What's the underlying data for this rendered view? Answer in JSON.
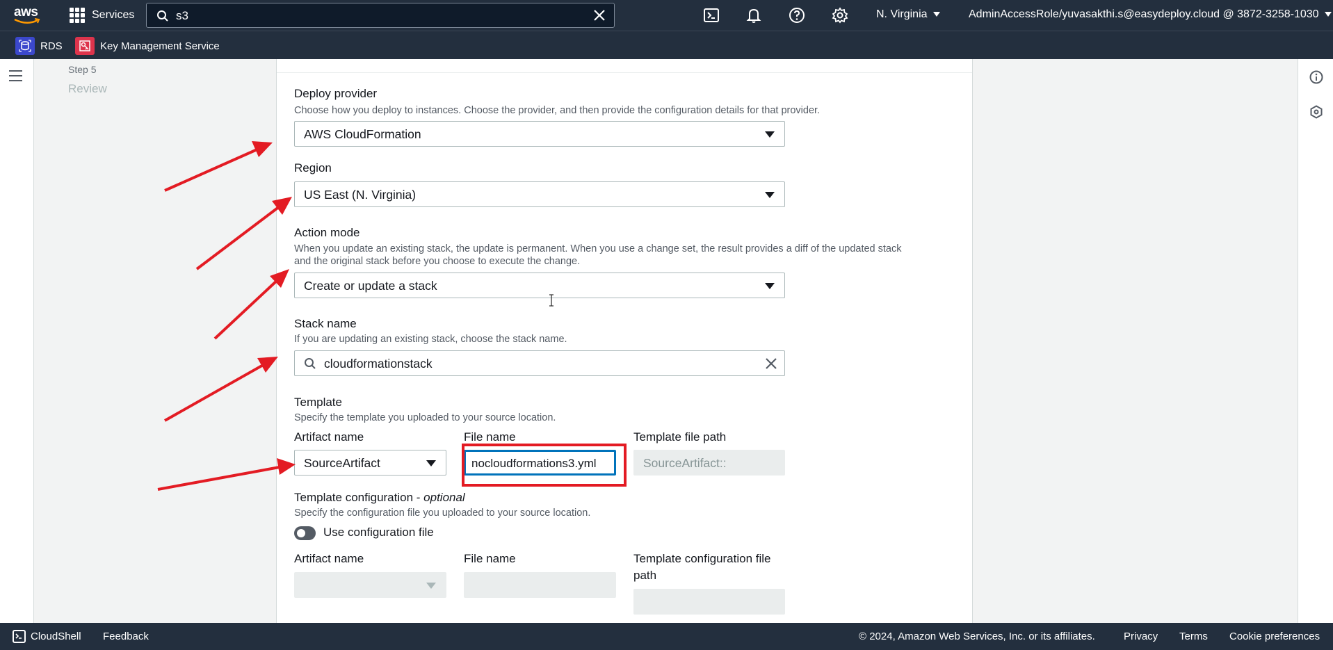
{
  "topnav": {
    "logo_text": "aws",
    "services_label": "Services",
    "search_value": "s3",
    "region": "N. Virginia",
    "account": "AdminAccessRole/yuvasakthi.s@easydeploy.cloud @ 3872-3258-1030",
    "icons": [
      "cloudshell-icon",
      "bell-icon",
      "help-icon",
      "gear-icon"
    ]
  },
  "favorites": [
    {
      "label": "RDS",
      "icon": "rds-icon",
      "color": "#3b48cc"
    },
    {
      "label": "Key Management Service",
      "icon": "kms-icon",
      "color": "#dd344c"
    }
  ],
  "stepnav": {
    "step_label": "Step 5",
    "step_title": "Review"
  },
  "form": {
    "deploy_provider": {
      "label": "Deploy provider",
      "desc": "Choose how you deploy to instances. Choose the provider, and then provide the configuration details for that provider.",
      "value": "AWS CloudFormation"
    },
    "region": {
      "label": "Region",
      "value": "US East (N. Virginia)"
    },
    "action_mode": {
      "label": "Action mode",
      "desc_line1": "When you update an existing stack, the update is permanent. When you use a change set, the result provides a diff of the updated stack",
      "desc_line2": "and the original stack before you choose to execute the change.",
      "value": "Create or update a stack"
    },
    "stack_name": {
      "label": "Stack name",
      "desc": "If you are updating an existing stack, choose the stack name.",
      "value": "cloudformationstack"
    },
    "template": {
      "label": "Template",
      "desc": "Specify the template you uploaded to your source location.",
      "artifact_label": "Artifact name",
      "artifact_value": "SourceArtifact",
      "file_label": "File name",
      "file_value": "nocloudformations3.yml",
      "path_label": "Template file path",
      "path_value": "SourceArtifact::"
    },
    "template_config": {
      "label": "Template configuration - ",
      "optional": "optional",
      "desc": "Specify the configuration file you uploaded to your source location.",
      "toggle_label": "Use configuration file",
      "toggle_on": false,
      "artifact_label": "Artifact name",
      "file_label": "File name",
      "path_label_line1": "Template configuration file",
      "path_label_line2": "path"
    }
  },
  "footer": {
    "cloudshell": "CloudShell",
    "feedback": "Feedback",
    "copyright": "© 2024, Amazon Web Services, Inc. or its affiliates.",
    "privacy": "Privacy",
    "terms": "Terms",
    "cookies": "Cookie preferences"
  },
  "annotation_color": "#e31b23"
}
